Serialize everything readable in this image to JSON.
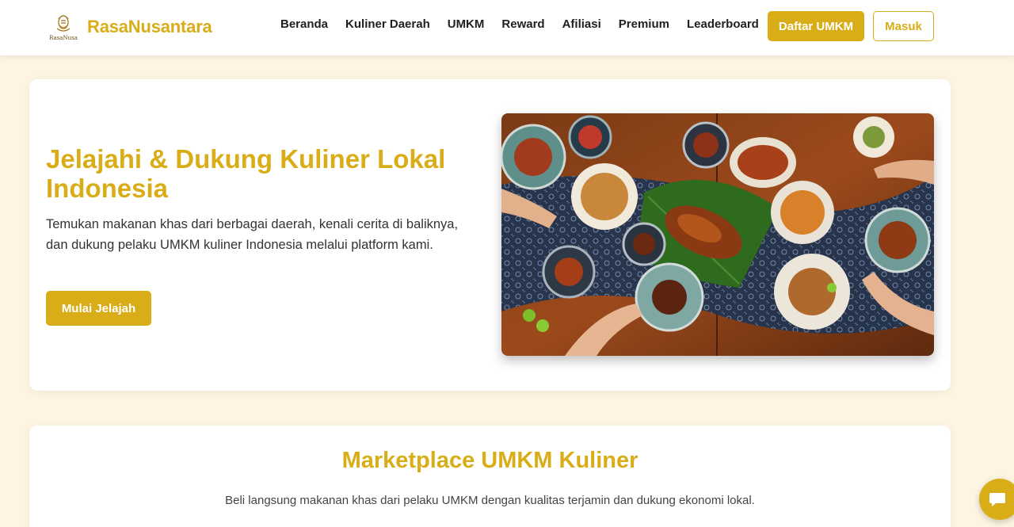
{
  "brand": {
    "logo_text": "RasaNusa",
    "name": "RasaNusantara"
  },
  "nav": {
    "items": [
      "Beranda",
      "Kuliner Daerah",
      "UMKM",
      "Reward",
      "Afiliasi",
      "Premium",
      "Leaderboard"
    ],
    "daftar_label": "Daftar UMKM",
    "masuk_label": "Masuk"
  },
  "hero": {
    "title": "Jelajahi & Dukung Kuliner Lokal Indonesia",
    "description": "Temukan makanan khas dari berbagai daerah, kenali cerita di baliknya, dan dukung pelaku UMKM kuliner Indonesia melalui platform kami.",
    "cta_label": "Mulai Jelajah",
    "image": "indonesian-food-table-photo"
  },
  "marketplace": {
    "title": "Marketplace UMKM Kuliner",
    "description": "Beli langsung makanan khas dari pelaku UMKM dengan kualitas terjamin dan dukung ekonomi lokal."
  },
  "chat": {
    "icon": "chat-bubble-icon"
  },
  "colors": {
    "accent": "#d9ad18",
    "page_background": "#fdf5e2",
    "card_background": "#ffffff"
  }
}
